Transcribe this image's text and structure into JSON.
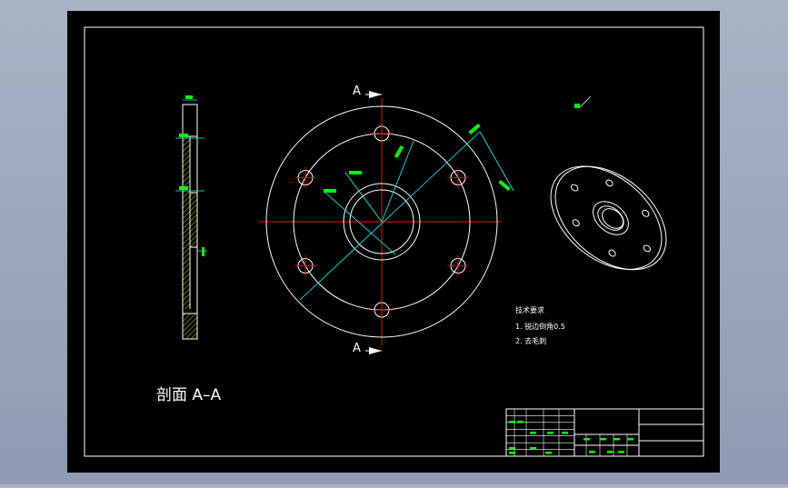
{
  "colors": {
    "background": "#000000",
    "border": "#ffffff",
    "geometry": "#ffffff",
    "centerline": "#ff0000",
    "dimension": "#00ffff",
    "dim_text": "#00ff00",
    "hatch": "#ffff00",
    "outer_bg": "#9aa5bb"
  },
  "drawing": {
    "section_title": "剖面 A–A",
    "section_mark_top": "A",
    "section_mark_bottom": "A",
    "tech_requirements": {
      "title": "技术要求",
      "items": [
        "1. 锐边倒角0.5",
        "2. 去毛刺"
      ]
    }
  },
  "title_block": {
    "rows": 7
  }
}
